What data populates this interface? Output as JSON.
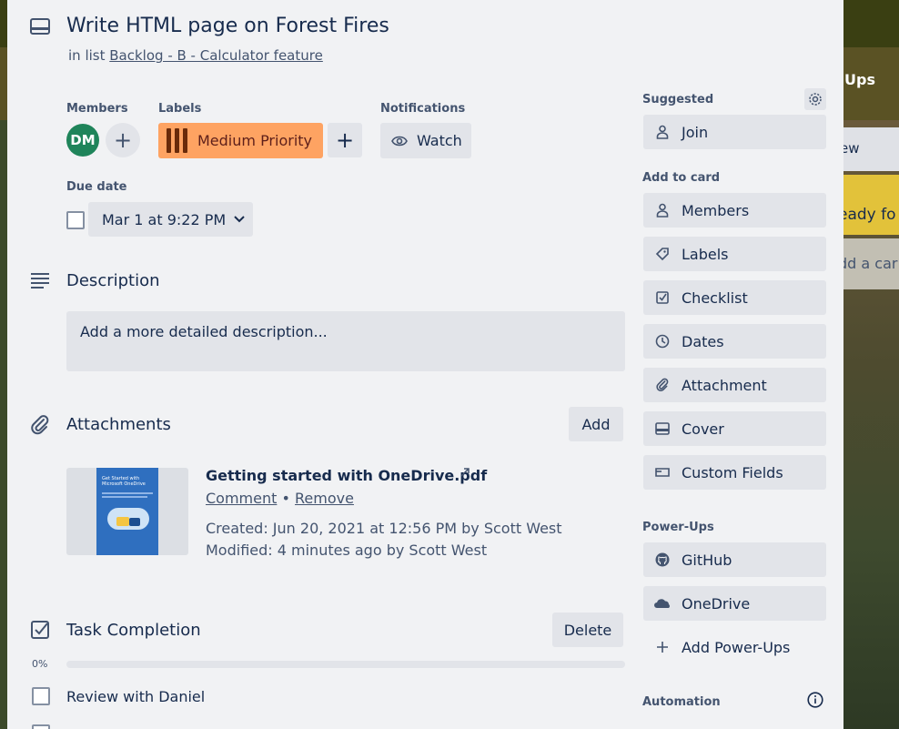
{
  "background": {
    "header_right_text": "Ups",
    "card1_text": "ew",
    "card2_text": "eady fo",
    "add_card_text": "dd a car"
  },
  "card": {
    "title": "Write HTML page on Forest Fires",
    "in_list_prefix": "in list",
    "list_name": "Backlog - B - Calculator feature"
  },
  "members": {
    "heading": "Members",
    "avatar_initials": "DM",
    "add_label": "+"
  },
  "labels": {
    "heading": "Labels",
    "items": [
      {
        "text": "Medium Priority",
        "color": "#fea362"
      }
    ],
    "add_label": "+"
  },
  "notifications": {
    "heading": "Notifications",
    "watch_label": "Watch"
  },
  "due_date": {
    "heading": "Due date",
    "value": "Mar 1 at 9:22 PM"
  },
  "description": {
    "heading": "Description",
    "placeholder": "Add a more detailed description..."
  },
  "attachments": {
    "heading": "Attachments",
    "add_label": "Add",
    "items": [
      {
        "name": "Getting started with OneDrive.pdf",
        "comment_label": "Comment",
        "separator": "•",
        "remove_label": "Remove",
        "created": "Created: Jun 20, 2021 at 12:56 PM by Scott West",
        "modified": "Modified: 4 minutes ago by Scott West",
        "thumbnail_title": "Get Started with Microsoft OneDrive"
      }
    ]
  },
  "checklist": {
    "heading": "Task Completion",
    "delete_label": "Delete",
    "progress_text": "0%",
    "progress": 0,
    "items": [
      {
        "text": "Review with Daniel",
        "checked": false
      }
    ]
  },
  "sidebar": {
    "suggested_heading": "Suggested",
    "join_label": "Join",
    "add_to_card_heading": "Add to card",
    "add_to_card": [
      {
        "label": "Members",
        "icon": "person-icon"
      },
      {
        "label": "Labels",
        "icon": "tag-icon"
      },
      {
        "label": "Checklist",
        "icon": "checklist-icon"
      },
      {
        "label": "Dates",
        "icon": "clock-icon"
      },
      {
        "label": "Attachment",
        "icon": "paperclip-icon"
      },
      {
        "label": "Cover",
        "icon": "cover-icon"
      },
      {
        "label": "Custom Fields",
        "icon": "custom-fields-icon"
      }
    ],
    "powerups_heading": "Power-Ups",
    "powerups": [
      {
        "label": "GitHub",
        "icon": "github-icon"
      },
      {
        "label": "OneDrive",
        "icon": "onedrive-icon"
      },
      {
        "label": "Add Power-Ups",
        "icon": "plus-icon"
      }
    ],
    "automation_heading": "Automation"
  }
}
